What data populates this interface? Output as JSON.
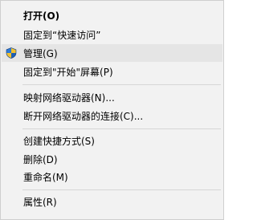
{
  "context_menu": {
    "items": [
      {
        "label": "打开(O)"
      },
      {
        "label": "固定到“快速访问”"
      },
      {
        "label": "管理(G)",
        "icon": "shield-icon"
      },
      {
        "label": "固定到\"开始\"屏幕(P)"
      },
      {
        "label": "映射网络驱动器(N)..."
      },
      {
        "label": "断开网络驱动器的连接(C)..."
      },
      {
        "label": "创建快捷方式(S)"
      },
      {
        "label": "删除(D)"
      },
      {
        "label": "重命名(M)"
      },
      {
        "label": "属性(R)"
      }
    ],
    "colors": {
      "background": "#f2f2f2",
      "hover": "#e5e5e5",
      "separator": "#d6d6d6"
    }
  }
}
